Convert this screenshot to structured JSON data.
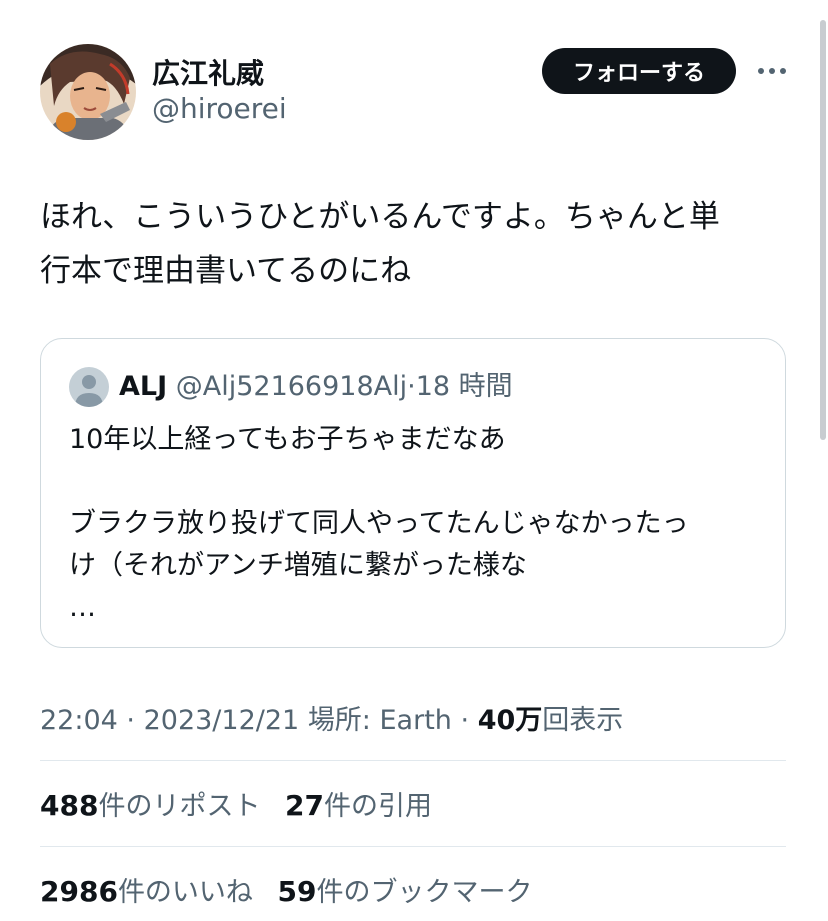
{
  "author": {
    "display_name": "広江礼威",
    "handle": "@hiroerei",
    "avatar_icon": "profile-illustration-avatar"
  },
  "follow_button_label": "フォローする",
  "more_icon": "ellipsis-icon",
  "tweet": {
    "line1": "ほれ、こういうひとがいるんですよ。ちゃんと単",
    "line2": "行本で理由書いてるのにね"
  },
  "quoted": {
    "name": "ALJ",
    "handle": "@Alj52166918Alj",
    "separator": "·",
    "time": "18 時間",
    "text_line1": "10年以上経ってもお子ちゃまだなあ",
    "text_line2": "ブラクラ放り投げて同人やってたんじゃなかったっ",
    "text_line3": "け（それがアンチ増殖に繋がった様な",
    "text_line4": "…"
  },
  "meta": {
    "time": "22:04",
    "sep1": "·",
    "date": "2023/12/21",
    "location": "場所: Earth",
    "sep2": "·",
    "views_count": "40万",
    "views_label": "回表示"
  },
  "stats": {
    "reposts_count": "488",
    "reposts_label": "件のリポスト",
    "quotes_count": "27",
    "quotes_label": "件の引用",
    "likes_count": "2986",
    "likes_label": "件のいいね",
    "bookmarks_count": "59",
    "bookmarks_label": "件のブックマーク"
  },
  "colors": {
    "text_primary": "#0f1419",
    "text_secondary": "#536471",
    "border": "#cfd9de",
    "button_bg": "#0f1419",
    "button_text": "#ffffff"
  }
}
